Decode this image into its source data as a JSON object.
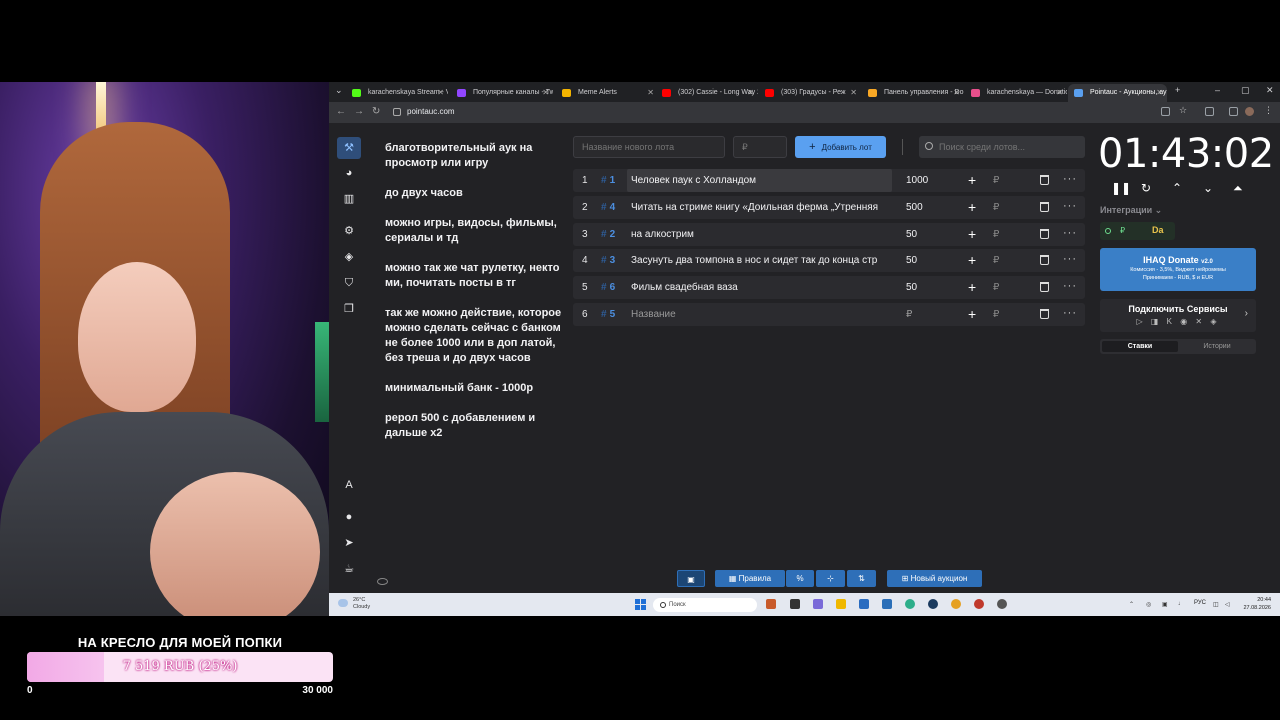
{
  "goal": {
    "title": "НА КРЕСЛО ДЛЯ МОЕЙ ПОПКИ",
    "amount": "7 519 RUB (25%)",
    "progress": 0.25,
    "min": "0",
    "max": "30 000"
  },
  "browser": {
    "tabs": [
      {
        "label": "karachenskaya Stream - V",
        "color": "#53fc18"
      },
      {
        "label": "Популярные каналы - Tw",
        "color": "#9146ff"
      },
      {
        "label": "Meme Alerts",
        "color": "#f4b400"
      },
      {
        "label": "(302) Cassie - Long Way 2",
        "color": "#ff0000"
      },
      {
        "label": "(303) Градусы - Реж",
        "color": "#ff0000"
      },
      {
        "label": "Панель управления - Do",
        "color": "#f9a825"
      },
      {
        "label": "karachenskaya — Donatio",
        "color": "#e84f8c"
      },
      {
        "label": "Pointauc - Аукционы, ау",
        "color": "#5aa0f0"
      }
    ],
    "url": "pointauc.com"
  },
  "description": [
    "благотворительный аук на просмотр или игру",
    "до  двух часов",
    "можно игры, видосы, фильмы, сериалы и тд",
    "можно так же чат рулетку, некто ми, почитать посты в тг",
    "так же можно действие, которое можно сделать сейчас с банком не более 1000 или в доп латой, без треша  и до двух часов",
    "минимальный банк - 1000р",
    "рерол 500 с добавлением и дальше х2"
  ],
  "controls": {
    "lot_name_placeholder": "Название нового лота",
    "lot_price_placeholder": "₽",
    "add_lot": "Добавить лот",
    "search_placeholder": "Поиск среди лотов..."
  },
  "lots": [
    {
      "index": "1",
      "code": "1",
      "name": "Человек паук с Холландом",
      "amount": "1000"
    },
    {
      "index": "2",
      "code": "4",
      "name": "Читать на стриме книгу «Доильная ферма „Утренняя",
      "amount": "500"
    },
    {
      "index": "3",
      "code": "2",
      "name": "на алкострим",
      "amount": "50"
    },
    {
      "index": "4",
      "code": "3",
      "name": "Засунуть два томпона в нос и сидет так до конца стр",
      "amount": "50"
    },
    {
      "index": "5",
      "code": "6",
      "name": "Фильм свадебная ваза",
      "amount": "50"
    },
    {
      "index": "6",
      "code": "5",
      "name": "Название",
      "amount": "₽"
    }
  ],
  "currency": "₽",
  "timer": "01:43:02",
  "integrations": {
    "label": "Интеграции",
    "item1": "₽",
    "item2": "Da"
  },
  "donate_card": {
    "title": "IHAQ Donate",
    "version": "v2.0",
    "subtitle": "Комиссия - 3,5%, Виджет нейромемы",
    "payments": "Принимаем - RUB, $ и EUR"
  },
  "connect": {
    "title": "Подключить Сервисы",
    "icons": "▷ ◨ K ◉ ✕ ◈"
  },
  "bid_tabs": [
    "Ставки",
    "Истории"
  ],
  "toolbar": {
    "rules": "Правила",
    "percent": "%",
    "new_auction": "Новый аукцион"
  },
  "taskbar": {
    "weather_temp": "26°C",
    "weather_desc": "Cloudy",
    "search": "Поиск",
    "lang": "РУС",
    "time": "20:44",
    "date": "27.08.2026"
  }
}
